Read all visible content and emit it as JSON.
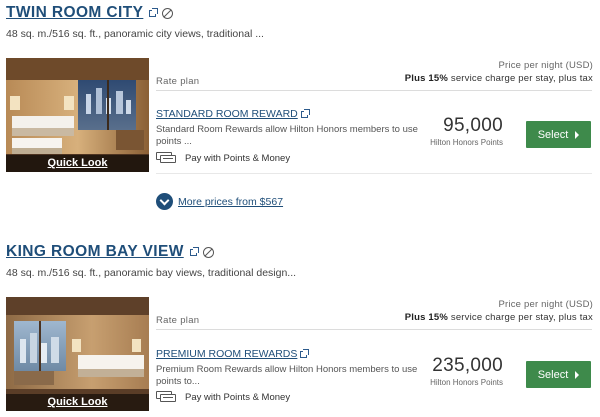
{
  "rooms": [
    {
      "title": "TWIN ROOM CITY",
      "description": "48 sq. m./516 sq. ft., panoramic city views, traditional ...",
      "quick_look": "Quick Look",
      "rate_header": {
        "rate_plan": "Rate plan",
        "price_per_night": "Price per night (USD)",
        "plus": "Plus",
        "percent": "15%",
        "service_charge": " service charge per stay, plus tax"
      },
      "plan": {
        "name": "STANDARD ROOM REWARD",
        "description": "Standard Room Rewards allow Hilton Honors members to use points ...",
        "pay_option": "Pay with Points & Money",
        "points": "95,000",
        "points_label": "Hilton Honors Points",
        "select_label": "Select"
      },
      "more_prices": "More prices from $567"
    },
    {
      "title": "KING ROOM BAY VIEW",
      "description": "48 sq. m./516 sq. ft., panoramic bay views, traditional design...",
      "quick_look": "Quick Look",
      "rate_header": {
        "rate_plan": "Rate plan",
        "price_per_night": "Price per night (USD)",
        "plus": "Plus",
        "percent": "15%",
        "service_charge": " service charge per stay, plus tax"
      },
      "plan": {
        "name": "PREMIUM ROOM REWARDS",
        "description": "Premium Room Rewards allow Hilton Honors members to use points to...",
        "pay_option": "Pay with Points & Money",
        "points": "235,000",
        "points_label": "Hilton Honors Points",
        "select_label": "Select"
      }
    }
  ],
  "colors": {
    "link": "#1f4e79",
    "select_button": "#3e8a4b"
  },
  "icons": [
    "external-link-icon",
    "no-smoking-icon",
    "points-money-icon",
    "chevron-right-icon",
    "chevron-down-icon"
  ]
}
